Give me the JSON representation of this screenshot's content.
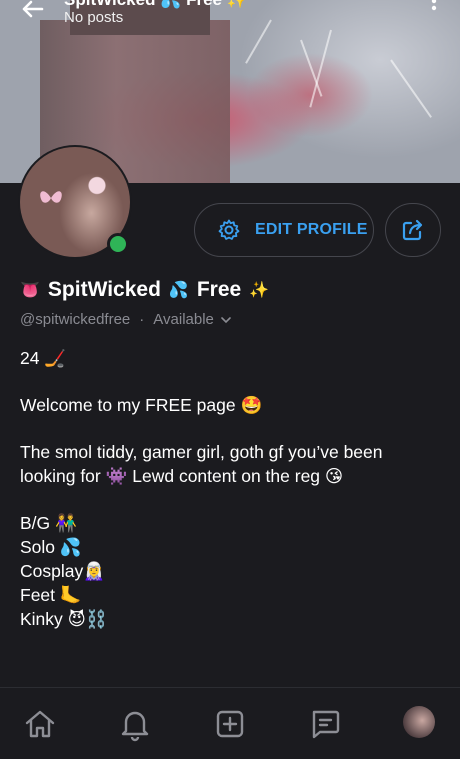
{
  "header": {
    "title": "SpitWicked 💦 Free ✨",
    "subtitle": "No posts"
  },
  "profile": {
    "display_name": "SpitWicked",
    "name_prefix_emoji": "👅",
    "name_mid_emoji": "💦",
    "name_suffix": "Free",
    "name_suffix_emoji": "✨",
    "handle": "@spitwickedfree",
    "separator": "·",
    "availability": "Available",
    "online_status_color": "#2fb457"
  },
  "actions": {
    "edit_profile_label": "EDIT PROFILE",
    "accent_color": "#3aa0f0"
  },
  "bio": {
    "line1": "24 🏒",
    "line2": "Welcome to my FREE page 🤩",
    "line3": "The smol tiddy, gamer girl, goth gf you’ve been looking for 👾 Lewd content on the reg 😘",
    "list": [
      "B/G 👫",
      "Solo 💦",
      "Cosplay🧝‍♀️",
      "Feet 🦶",
      "Kinky 😈⛓️"
    ]
  },
  "nav": {
    "icons": [
      "home-icon",
      "bell-icon",
      "plus-square-icon",
      "message-icon",
      "profile-avatar"
    ]
  }
}
